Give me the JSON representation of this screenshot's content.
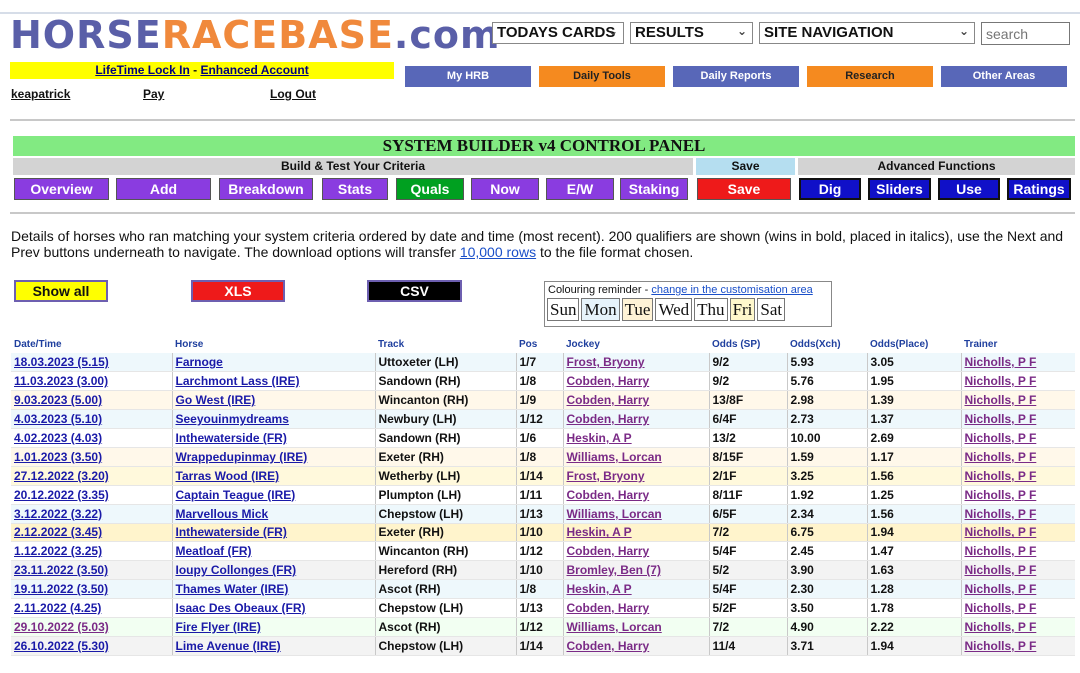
{
  "logo": {
    "part1": "HORSE",
    "part2": "RACEBASE",
    "part3": ".com"
  },
  "header": {
    "selects": [
      "TODAYS CARDS",
      "RESULTS",
      "SITE NAVIGATION"
    ],
    "search_placeholder": "search"
  },
  "account": {
    "lifetime": "LifeTime Lock In",
    "sep": " - ",
    "enhanced": "Enhanced Account",
    "username": "keapatrick",
    "pay": "Pay",
    "logout": "Log Out"
  },
  "nav": [
    "My HRB",
    "Daily Tools",
    "Daily Reports",
    "Research",
    "Other Areas"
  ],
  "panel": {
    "title": "SYSTEM BUILDER v4 CONTROL PANEL",
    "sections": [
      "Build & Test Your Criteria",
      "Save",
      "Advanced Functions"
    ],
    "buttons": [
      "Overview",
      "Add",
      "Breakdown",
      "Stats",
      "Quals",
      "Now",
      "E/W",
      "Staking",
      "Save",
      "Dig",
      "Sliders",
      "Use",
      "Ratings"
    ]
  },
  "description": {
    "text1": "Details of horses who ran matching your system criteria ordered by date and time (most recent). 200 qualifiers are shown (wins in bold, placed in italics), use the Next and Prev buttons underneath to navigate. The download options will transfer ",
    "link": "10,000 rows",
    "text2": " to the file format chosen."
  },
  "downloads": {
    "show_all": "Show all",
    "xls": "XLS",
    "csv": "CSV"
  },
  "reminder": {
    "label": "Colouring reminder - ",
    "link": "change in the customisation area",
    "days": [
      "Sun",
      "Mon",
      "Tue",
      "Wed",
      "Thu",
      "Fri",
      "Sat"
    ],
    "day_colors": [
      "#ffffff",
      "#e6f3fb",
      "#fff3d6",
      "#ffffff",
      "#ffffff",
      "#fff8cc",
      "#ffffff"
    ]
  },
  "table": {
    "headers": [
      "Date/Time",
      "Horse",
      "Track",
      "Pos",
      "Jockey",
      "Odds (SP)",
      "Odds(Xch)",
      "Odds(Place)",
      "Trainer"
    ],
    "rows": [
      {
        "date": "18.03.2023 (5.15)",
        "horse": "Farnoge",
        "track": "Uttoxeter (LH)",
        "pos": "1/7",
        "jockey": "Frost, Bryony",
        "sp": "9/2",
        "xch": "5.93",
        "place": "3.05",
        "trainer": "Nicholls, P F"
      },
      {
        "date": "11.03.2023 (3.00)",
        "horse": "Larchmont Lass (IRE)",
        "track": "Sandown (RH)",
        "pos": "1/8",
        "jockey": "Cobden, Harry",
        "sp": "9/2",
        "xch": "5.76",
        "place": "1.95",
        "trainer": "Nicholls, P F"
      },
      {
        "date": "9.03.2023 (5.00)",
        "horse": "Go West (IRE)",
        "track": "Wincanton (RH)",
        "pos": "1/9",
        "jockey": "Cobden, Harry",
        "sp": "13/8F",
        "xch": "2.98",
        "place": "1.39",
        "trainer": "Nicholls, P F"
      },
      {
        "date": "4.03.2023 (5.10)",
        "horse": "Seeyouinmydreams",
        "track": "Newbury (LH)",
        "pos": "1/12",
        "jockey": "Cobden, Harry",
        "sp": "6/4F",
        "xch": "2.73",
        "place": "1.37",
        "trainer": "Nicholls, P F"
      },
      {
        "date": "4.02.2023 (4.03)",
        "horse": "Inthewaterside (FR)",
        "track": "Sandown (RH)",
        "pos": "1/6",
        "jockey": "Heskin, A P",
        "sp": "13/2",
        "xch": "10.00",
        "place": "2.69",
        "trainer": "Nicholls, P F"
      },
      {
        "date": "1.01.2023 (3.50)",
        "horse": "Wrappedupinmay (IRE)",
        "track": "Exeter (RH)",
        "pos": "1/8",
        "jockey": "Williams, Lorcan",
        "sp": "8/15F",
        "xch": "1.59",
        "place": "1.17",
        "trainer": "Nicholls, P F"
      },
      {
        "date": "27.12.2022 (3.20)",
        "horse": "Tarras Wood (IRE)",
        "track": "Wetherby (LH)",
        "pos": "1/14",
        "jockey": "Frost, Bryony",
        "sp": "2/1F",
        "xch": "3.25",
        "place": "1.56",
        "trainer": "Nicholls, P F"
      },
      {
        "date": "20.12.2022 (3.35)",
        "horse": "Captain Teague (IRE)",
        "track": "Plumpton (LH)",
        "pos": "1/11",
        "jockey": "Cobden, Harry",
        "sp": "8/11F",
        "xch": "1.92",
        "place": "1.25",
        "trainer": "Nicholls, P F"
      },
      {
        "date": "3.12.2022 (3.22)",
        "horse": "Marvellous Mick",
        "track": "Chepstow (LH)",
        "pos": "1/13",
        "jockey": "Williams, Lorcan",
        "sp": "6/5F",
        "xch": "2.34",
        "place": "1.56",
        "trainer": "Nicholls, P F"
      },
      {
        "date": "2.12.2022 (3.45)",
        "horse": "Inthewaterside (FR)",
        "track": "Exeter (RH)",
        "pos": "1/10",
        "jockey": "Heskin, A P",
        "sp": "7/2",
        "xch": "6.75",
        "place": "1.94",
        "trainer": "Nicholls, P F"
      },
      {
        "date": "1.12.2022 (3.25)",
        "horse": "Meatloaf (FR)",
        "track": "Wincanton (RH)",
        "pos": "1/12",
        "jockey": "Cobden, Harry",
        "sp": "5/4F",
        "xch": "2.45",
        "place": "1.47",
        "trainer": "Nicholls, P F"
      },
      {
        "date": "23.11.2022 (3.50)",
        "horse": "Ioupy Collonges (FR)",
        "track": "Hereford (RH)",
        "pos": "1/10",
        "jockey": "Bromley, Ben (7)",
        "sp": "5/2",
        "xch": "3.90",
        "place": "1.63",
        "trainer": "Nicholls, P F"
      },
      {
        "date": "19.11.2022 (3.50)",
        "horse": "Thames Water (IRE)",
        "track": "Ascot (RH)",
        "pos": "1/8",
        "jockey": "Heskin, A P",
        "sp": "5/4F",
        "xch": "2.30",
        "place": "1.28",
        "trainer": "Nicholls, P F"
      },
      {
        "date": "2.11.2022 (4.25)",
        "horse": "Isaac Des Obeaux (FR)",
        "track": "Chepstow (LH)",
        "pos": "1/13",
        "jockey": "Cobden, Harry",
        "sp": "5/2F",
        "xch": "3.50",
        "place": "1.78",
        "trainer": "Nicholls, P F"
      },
      {
        "date": "29.10.2022 (5.03)",
        "horse": "Fire Flyer (IRE)",
        "track": "Ascot (RH)",
        "pos": "1/12",
        "jockey": "Williams, Lorcan",
        "sp": "7/2",
        "xch": "4.90",
        "place": "2.22",
        "trainer": "Nicholls, P F"
      },
      {
        "date": "26.10.2022 (5.30)",
        "horse": "Lime Avenue (IRE)",
        "track": "Chepstow (LH)",
        "pos": "1/14",
        "jockey": "Cobden, Harry",
        "sp": "11/4",
        "xch": "3.71",
        "place": "1.94",
        "trainer": "Nicholls, P F"
      }
    ],
    "row_colors": [
      "#eef8fc",
      "#ffffff",
      "#fff8ea",
      "#eef8fc",
      "#ffffff",
      "#fff8ea",
      "#fff9dc",
      "#ffffff",
      "#eef8fc",
      "#fff4cc",
      "#ffffff",
      "#f3f3f3",
      "#eef8fc",
      "#ffffff",
      "#f2fff2",
      "#f3f3f3"
    ]
  }
}
